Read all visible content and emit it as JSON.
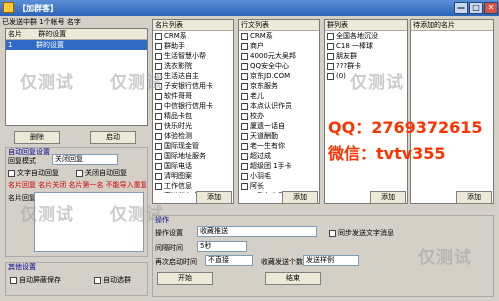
{
  "window": {
    "title": "【加群客】",
    "min": "—",
    "max": "□",
    "close": "✕"
  },
  "toolbar": {
    "label_left": "加群客",
    "label_count": "已发送中群 1个帐号 名字",
    "label_cols": "名片列表 | 行文列表 | 名字列表 | 行表"
  },
  "accounts": {
    "headers": [
      "名片",
      "群的设置"
    ],
    "rows": [
      [
        "1",
        "群的设置"
      ],
      [
        "2",
        ""
      ]
    ]
  },
  "name_list": {
    "header": "名片列表",
    "items": [
      "CRM系",
      "群助手",
      "生活智慧小帮",
      "洗衣影院",
      "生活达自主",
      "子安银行信用卡",
      "软件哥哥",
      "中信银行信用卡",
      "精品卡包",
      "快乐时光",
      "体验检测",
      "国际现金管",
      "国际地址服务",
      "国际电话",
      "清明图案",
      "工作信息",
      "高进伴台个人"
    ]
  },
  "row_list": {
    "header": "行文列表",
    "items": [
      "CRM系",
      "商户",
      "4000元大吴邦",
      "QQ安全中心",
      "京东JD.COM",
      "京东服务",
      "老儿",
      "本点认识作员",
      "校办",
      "厦遗一话自",
      "天道酬勤",
      "老一生有你",
      "超过成",
      "超级团 1手卡",
      "小羽毛",
      "阿长",
      "1.我在自己",
      "吴风林"
    ]
  },
  "group_list": {
    "header": "群列表",
    "items": [
      "全国各地沉没",
      "C18 一棒球",
      "朋友群",
      "???群卡",
      "(0)"
    ]
  },
  "pending": {
    "header": "待添加的名片",
    "items": []
  },
  "buttons": {
    "delete": "删除",
    "start": "启动",
    "add_card": "添加",
    "add_row": "添加",
    "add_group": "添加",
    "add_pending": "添加",
    "begin": "开始",
    "end": "结束"
  },
  "auto_reply": {
    "section": "自动回复设置",
    "mode_label": "回复模式",
    "mode_value": "关闭回复",
    "text_auto": "文字自动回复",
    "text_chk2": "关闭自动回复",
    "notice": "名片回复 名片关闭 名片第一名 不能导入重复回复的名片",
    "name_label": "名片回复"
  },
  "operation": {
    "section": "操作",
    "op_label": "操作设置",
    "op_value": "收藏推送",
    "interval_label": "间隔时间",
    "interval_value": "5秒",
    "other_label": "再次启动时间",
    "other_value": "不直接",
    "recv_label": "收藏发送个数",
    "recv_value": "发送样例",
    "chk_send": "同步发送文字消息"
  },
  "other": {
    "section": "其他设置",
    "auto_save": "自动屏蔽保存",
    "auto_proc": "自动选群"
  },
  "watermarks": [
    "仅测试",
    "仅测试",
    "仅测试",
    "仅测试",
    "仅测试",
    "仅测试"
  ],
  "promo": {
    "qq": "QQ：2769372615",
    "wechat": "微信：tvtv355"
  },
  "colors": {
    "title_bg": "#2d63b8",
    "promo": "#ff3300",
    "selection": "#316ac5"
  }
}
